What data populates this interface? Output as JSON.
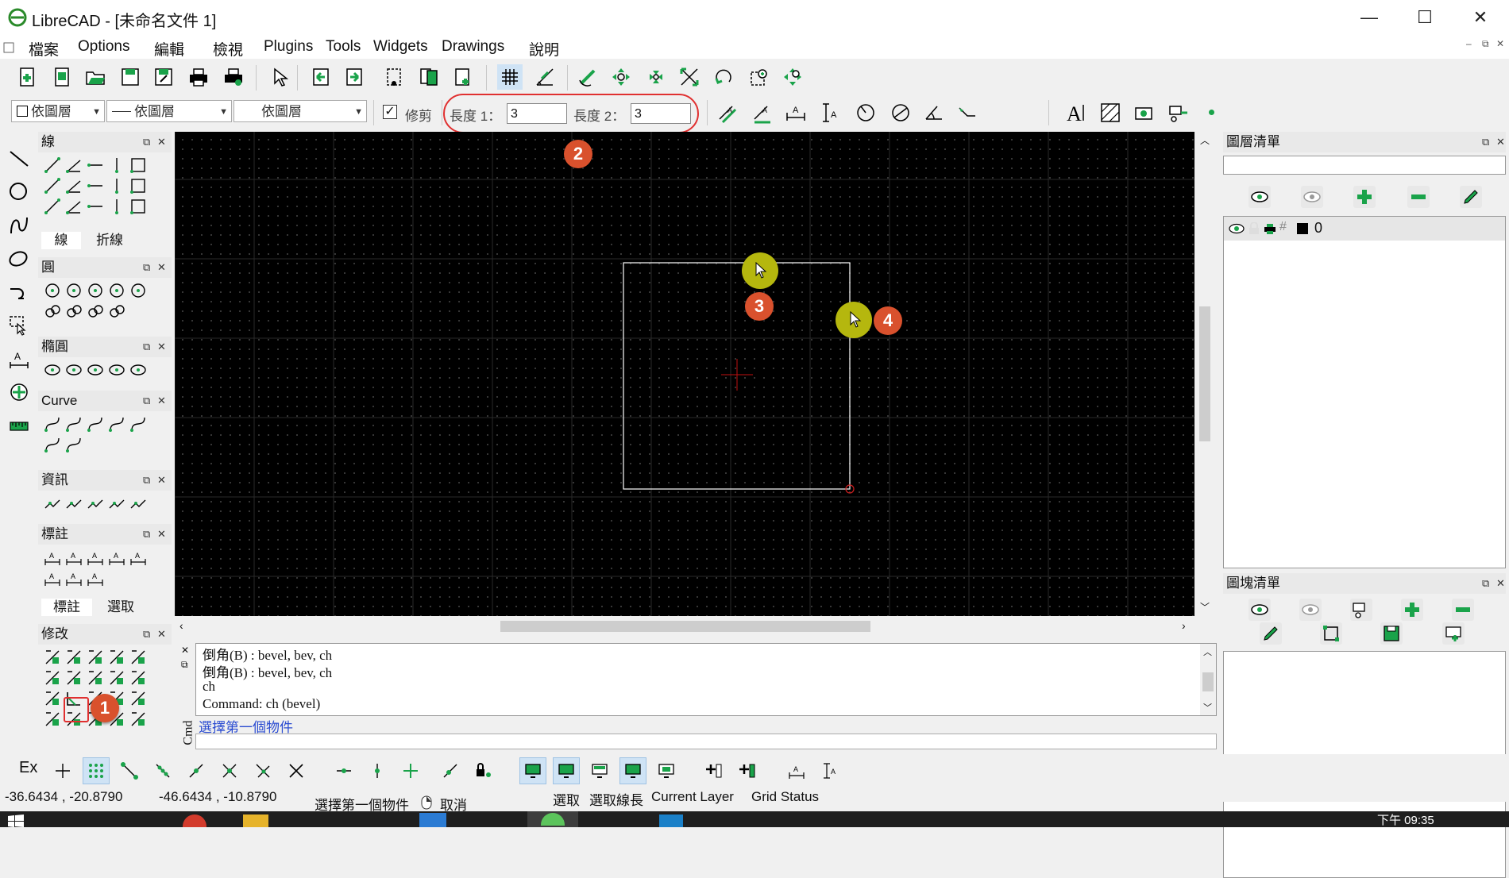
{
  "window": {
    "title": "LibreCAD - [未命名文件 1]",
    "minimize": "—",
    "maximize": "☐",
    "close": "✕"
  },
  "menu": {
    "items": [
      "檔案",
      "Options",
      "編輯",
      "檢視",
      "Plugins",
      "Tools",
      "Widgets",
      "Drawings",
      "說明"
    ]
  },
  "pen_toolbar": {
    "layer_combo": "依圖層",
    "linetype_combo": "依圖層",
    "width_combo": "依圖層"
  },
  "bevel_options": {
    "trim_label": "修剪",
    "trim_checked": true,
    "length1_label": "長度 1：",
    "length1_value": "3",
    "length2_label": "長度 2：",
    "length2_value": "3"
  },
  "left_docks": {
    "line": {
      "title": "線",
      "tabs": [
        "線",
        "折線"
      ]
    },
    "circle": {
      "title": "圓"
    },
    "ellipse": {
      "title": "橢圓"
    },
    "curve": {
      "title": "Curve"
    },
    "info": {
      "title": "資訊"
    },
    "dimension": {
      "title": "標註",
      "tabs": [
        "標註",
        "選取"
      ]
    },
    "modify": {
      "title": "修改"
    }
  },
  "layer_list": {
    "title": "圖層清單",
    "filter_placeholder": "",
    "layers": [
      {
        "name": "0",
        "color": "#000000"
      }
    ]
  },
  "block_list": {
    "title": "圖塊清單"
  },
  "command_panel": {
    "history": [
      "倒角(B) : bevel, bev, ch",
      "倒角(B) : bevel, bev, ch",
      "ch",
      "Command: ch (bevel)"
    ],
    "prompt": "選擇第一個物件",
    "label": "Cmd"
  },
  "snap_toolbar": {
    "ex_label": "Ex"
  },
  "status": {
    "abs_coords": "-36.6434 , -20.8790",
    "rel_coords": "-46.6434 , -10.8790",
    "left_action": "選擇第一個物件",
    "right_action": "取消",
    "select_label": "選取",
    "select_length_label": "選取線長",
    "current_layer_label": "Current Layer",
    "grid_status_label": "Grid Status"
  },
  "annotations": [
    "1",
    "2",
    "3",
    "4"
  ],
  "taskbar": {
    "time": "下午 09:35"
  },
  "colors": {
    "accent_green": "#1aa34a",
    "marker": "#d9512d",
    "highlight_oval": "#e03030",
    "cursor_halo": "#b5b70e"
  }
}
